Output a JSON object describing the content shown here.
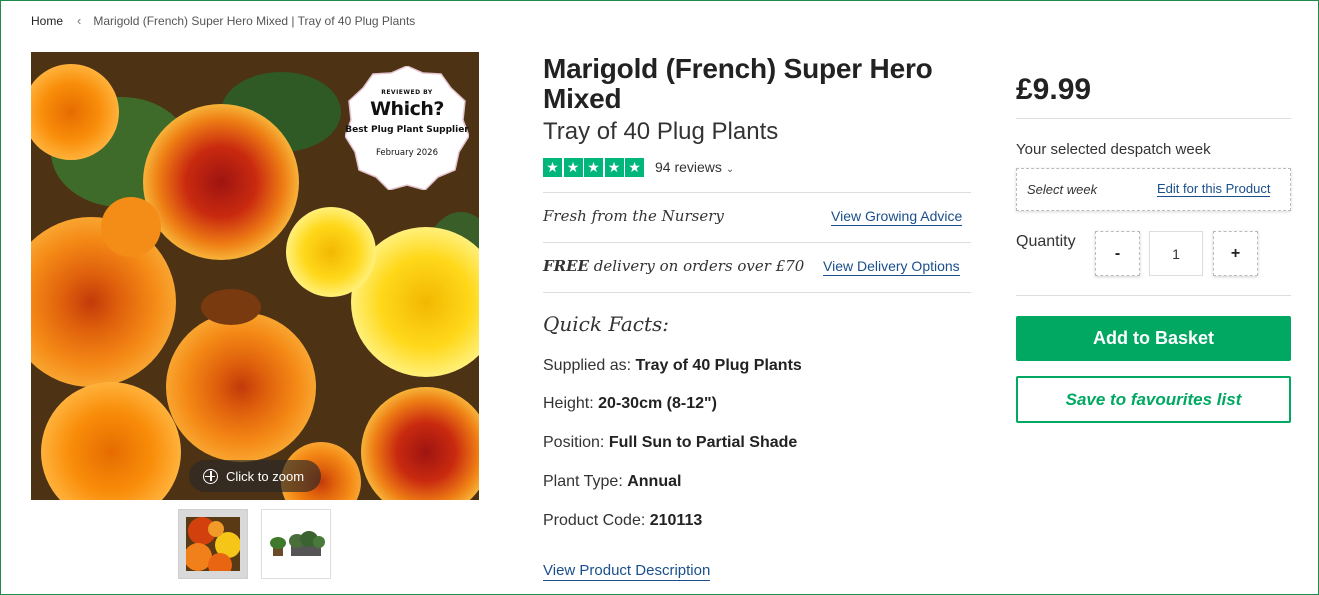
{
  "breadcrumb": {
    "home": "Home",
    "separator": "‹",
    "current": "Marigold (French) Super Hero Mixed | Tray of 40 Plug Plants"
  },
  "gallery": {
    "badge": {
      "reviewed_by": "REVIEWED BY",
      "brand": "Which?",
      "award": "Best Plug Plant Supplier",
      "date": "February 2026"
    },
    "zoom_label": "Click to zoom"
  },
  "product": {
    "title": "Marigold (French) Super Hero Mixed",
    "subtitle": "Tray of 40 Plug Plants",
    "rating_stars": 5,
    "reviews_label": "94 reviews",
    "fresh_text": "Fresh from the Nursery",
    "growing_advice_link": "View Growing Advice",
    "free_word": "FREE",
    "delivery_text": "delivery on orders over £70",
    "delivery_link": "View Delivery Options",
    "quick_facts_title": "Quick Facts:",
    "quick_facts": [
      {
        "label": "Supplied as:",
        "value": "Tray of 40 Plug Plants"
      },
      {
        "label": "Height:",
        "value": "20-30cm (8-12\")"
      },
      {
        "label": "Position:",
        "value": "Full Sun to Partial Shade"
      },
      {
        "label": "Plant Type:",
        "value": "Annual"
      },
      {
        "label": "Product Code:",
        "value": "210113"
      }
    ],
    "description_link": "View Product Description"
  },
  "purchase": {
    "price": "£9.99",
    "despatch_label": "Your selected despatch week",
    "select_week": "Select week",
    "edit_link": "Edit for this Product",
    "quantity_label": "Quantity",
    "minus": "-",
    "quantity": "1",
    "plus": "+",
    "add_button": "Add to Basket",
    "favourites_button": "Save to favourites list"
  },
  "colors": {
    "accent_green": "#00a862",
    "trustpilot_green": "#00b67a",
    "link_blue": "#1a4f8b"
  }
}
